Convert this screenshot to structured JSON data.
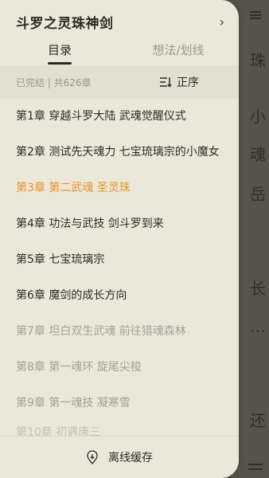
{
  "background_reader": {
    "chars": [
      "珠",
      "小",
      "魂",
      "岳",
      "长",
      "…",
      "还"
    ]
  },
  "drawer": {
    "book_title": "斗罗之灵珠神剑",
    "tabs": [
      {
        "label": "目录"
      },
      {
        "label": "想法/划线"
      }
    ],
    "status": "已完结 | 共626章",
    "sort_label": "正序",
    "chapters": [
      {
        "title": "第1章 穿越斗罗大陆 武魂觉醒仪式",
        "state": "read"
      },
      {
        "title": "第2章 测试先天魂力 七宝琉璃宗的小魔女",
        "state": "read"
      },
      {
        "title": "第3章 第二武魂 圣灵珠",
        "state": "current"
      },
      {
        "title": "第4章 功法与武技 剑斗罗到来",
        "state": "read"
      },
      {
        "title": "第5章 七宝琉璃宗",
        "state": "read"
      },
      {
        "title": "第6章 魔剑的成长方向",
        "state": "read"
      },
      {
        "title": "第7章 坦白双生武魂 前往猎魂森林",
        "state": "unread"
      },
      {
        "title": "第8章 第一魂环 旋尾尖梭",
        "state": "unread"
      },
      {
        "title": "第9章 第一魂技 凝寒雪",
        "state": "unread"
      },
      {
        "title": "第10章 初遇唐三",
        "state": "faded"
      }
    ],
    "offline_cache_label": "离线缓存"
  },
  "colors": {
    "drawer_bg": "#ece8d9",
    "accent": "#e8922c",
    "text_primary": "#2b2a26",
    "text_muted": "#a3a096"
  }
}
